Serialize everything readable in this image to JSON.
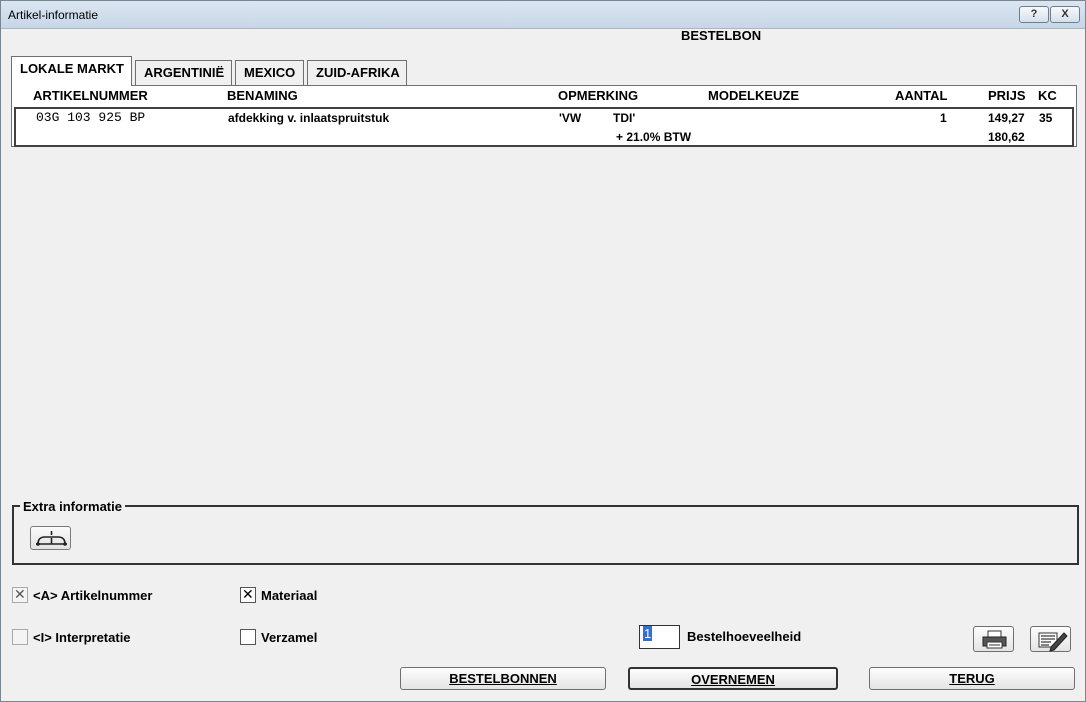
{
  "window": {
    "title": "Artikel-informatie",
    "help_glyph": "?",
    "close_glyph": "X"
  },
  "header": {
    "title": "BESTELBON"
  },
  "tabs": [
    {
      "label": "LOKALE MARKT",
      "active": true
    },
    {
      "label": "ARGENTINIË",
      "active": false
    },
    {
      "label": "MEXICO",
      "active": false
    },
    {
      "label": "ZUID-AFRIKA",
      "active": false
    }
  ],
  "table": {
    "columns": [
      "ARTIKELNUMMER",
      "BENAMING",
      "OPMERKING",
      "MODELKEUZE",
      "AANTAL",
      "PRIJS",
      "KC"
    ],
    "row": {
      "artikelnummer": "03G 103 925 BP",
      "benaming": "afdekking v. inlaatspruitstuk",
      "opmerking_1": "'VW",
      "opmerking_2": "TDI'",
      "aantal": "1",
      "prijs": "149,27",
      "kc": "35",
      "btw_label": "+ 21.0% BTW",
      "prijs_btw": "180,62"
    }
  },
  "extra": {
    "label": "Extra informatie",
    "icon": "network-node-icon"
  },
  "options": {
    "artikelnummer": {
      "label": "<A> Artikelnummer",
      "checked": true,
      "enabled": false
    },
    "interpretatie": {
      "label": "<I> Interpretatie",
      "checked": false,
      "enabled": false
    },
    "materiaal": {
      "label": "Materiaal",
      "checked": true,
      "enabled": true
    },
    "verzamel": {
      "label": "Verzamel",
      "checked": false,
      "enabled": true
    }
  },
  "quantity": {
    "value": "1",
    "label": "Bestelhoeveelheid"
  },
  "buttons": {
    "bestelbonnen": "BESTELBONNEN",
    "overnemen": "OVERNEMEN",
    "terug": "TERUG",
    "print_icon": "printer-icon",
    "edit_icon": "edit-list-icon"
  }
}
